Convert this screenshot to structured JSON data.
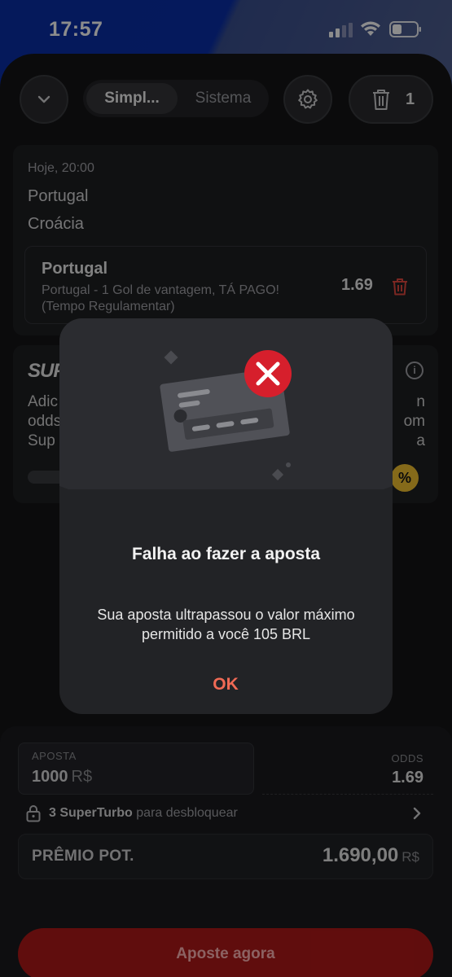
{
  "status_bar": {
    "time": "17:57"
  },
  "header": {
    "mode_tabs": [
      {
        "label": "Simpl..."
      },
      {
        "label": "Sistema"
      }
    ],
    "trash_count": "1"
  },
  "bet_card": {
    "event_time": "Hoje, 20:00",
    "team_home": "Portugal",
    "team_away": "Croácia",
    "selection": {
      "title": "Portugal",
      "description": "Portugal - 1 Gol de vantagem, TÁ PAGO! (Tempo Regulamentar)",
      "odds": "1.69"
    }
  },
  "superturbo_card": {
    "logo": "SUPE",
    "text_left": "Adic\nodds\nSup",
    "text_right": "n\nom a",
    "badge": "%"
  },
  "slip": {
    "stake_label": "APOSTA",
    "stake_value": "1000",
    "stake_currency": "R$",
    "odds_label": "ODDS",
    "odds_value": "1.69",
    "unlock_count": "3 SuperTurbo",
    "unlock_text": " para desbloquear",
    "prize_label": "PRÊMIO POT.",
    "prize_value": "1.690,00",
    "prize_currency": "R$",
    "place_bet_label": "Aposte agora"
  },
  "modal": {
    "title": "Falha ao fazer a aposta",
    "message": "Sua aposta ultrapassou o valor máximo permitido a você 105 BRL",
    "ok_label": "OK"
  },
  "colors": {
    "accent_red": "#b01818",
    "error_red": "#d61f2c",
    "ok_text": "#f06a55",
    "badge_yellow": "#f2c230"
  }
}
